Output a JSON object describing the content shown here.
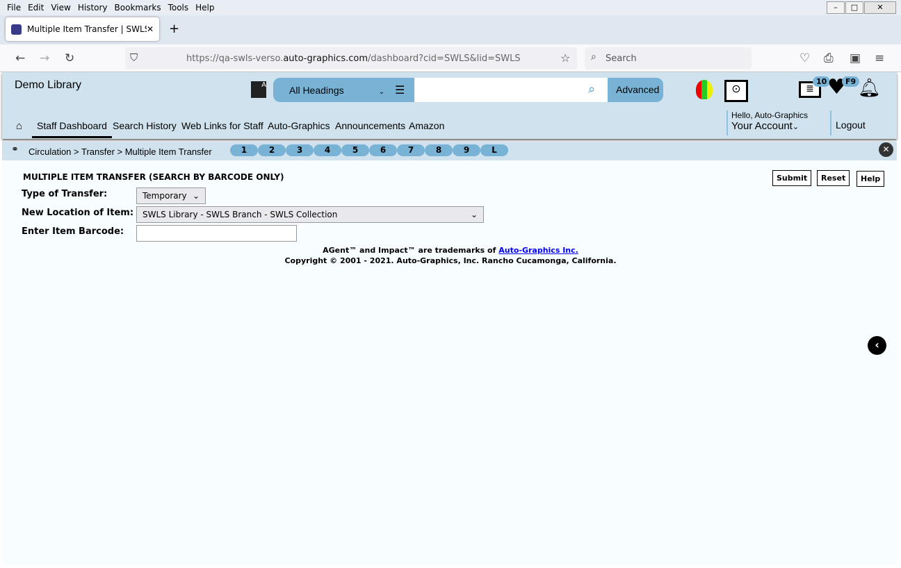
{
  "browser": {
    "menu": [
      "File",
      "Edit",
      "View",
      "History",
      "Bookmarks",
      "Tools",
      "Help"
    ],
    "tab_title": "Multiple Item Transfer | SWLS | s",
    "url_prefix": "https://qa-swls-verso.",
    "url_domain": "auto-graphics.com",
    "url_rest": "/dashboard?cid=SWLS&lid=SWLS",
    "search_placeholder": "Search"
  },
  "header": {
    "library": "Demo Library",
    "search_scope": "All Headings",
    "advanced": "Advanced",
    "list_count": "10",
    "fav_badge": "F9",
    "greeting": "Hello, Auto-Graphics",
    "account": "Your Account",
    "logout": "Logout"
  },
  "nav": [
    "Staff Dashboard",
    "Search History",
    "Web Links for Staff",
    "Auto-Graphics",
    "Announcements",
    "Amazon"
  ],
  "breadcrumb": "Circulation > Transfer > Multiple Item Transfer",
  "quick_pills": [
    "1",
    "2",
    "3",
    "4",
    "5",
    "6",
    "7",
    "8",
    "9",
    "L"
  ],
  "form": {
    "title": "MULTIPLE ITEM TRANSFER (SEARCH BY BARCODE ONLY)",
    "type_label": "Type of Transfer:",
    "type_value": "Temporary",
    "location_label": "New Location of Item:",
    "location_value": "SWLS Library - SWLS Branch - SWLS Collection",
    "barcode_label": "Enter Item Barcode:",
    "barcode_value": "",
    "submit": "Submit",
    "reset": "Reset",
    "help": "Help"
  },
  "footer": {
    "trademark": "AGent™ and Impact™ are trademarks of ",
    "trademark_link": "Auto-Graphics Inc.",
    "copyright": "Copyright © 2001 - 2021. Auto-Graphics, Inc. Rancho Cucamonga, California."
  },
  "colors": {
    "header_bg": "#cfe2ee",
    "accent": "#78b3d6"
  }
}
